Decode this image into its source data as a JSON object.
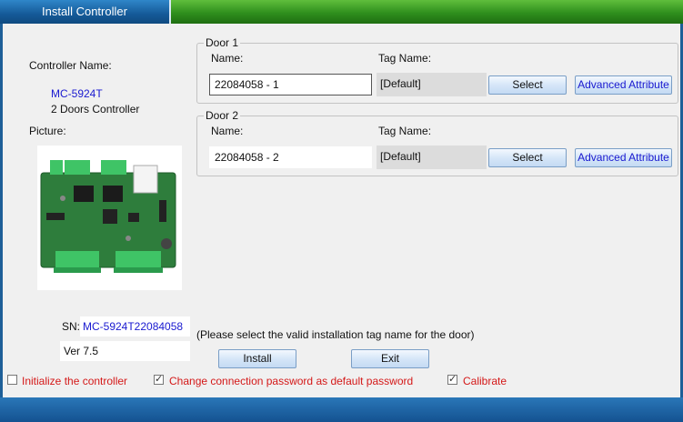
{
  "window": {
    "title": "Install Controller"
  },
  "controller": {
    "name_label": "Controller Name:",
    "model": "MC-5924T",
    "description": "2 Doors Controller",
    "picture_label": "Picture:",
    "sn_label": "SN:",
    "sn_value": "MC-5924T22084058",
    "version": "Ver 7.5"
  },
  "doors": [
    {
      "legend": "Door 1",
      "name_label": "Name:",
      "name_value": "22084058 - 1",
      "tag_label": "Tag Name:",
      "tag_value": "[Default]",
      "select_label": "Select",
      "advanced_label": "Advanced Attribute"
    },
    {
      "legend": "Door 2",
      "name_label": "Name:",
      "name_value": "22084058 - 2",
      "tag_label": "Tag Name:",
      "tag_value": "[Default]",
      "select_label": "Select",
      "advanced_label": "Advanced Attribute"
    }
  ],
  "hint": "(Please select the valid installation tag name for the door)",
  "buttons": {
    "install": "Install",
    "exit": "Exit"
  },
  "options": [
    {
      "label": "Initialize the controller",
      "checked": false
    },
    {
      "label": "Change connection password as default password",
      "checked": true
    },
    {
      "label": "Calibrate",
      "checked": true
    }
  ]
}
